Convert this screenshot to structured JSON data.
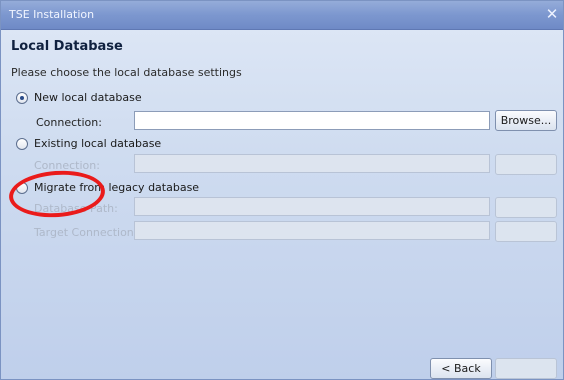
{
  "window": {
    "title": "TSE Installation",
    "close_icon": "close-icon"
  },
  "page": {
    "heading": "Local Database",
    "subheading": "Please choose the local database settings"
  },
  "options": {
    "new_db": {
      "label": "New local database",
      "selected": true
    },
    "existing_db": {
      "label": "Existing local database",
      "selected": false
    },
    "migrate_db": {
      "label": "Migrate from legacy database",
      "selected": false
    }
  },
  "fields": {
    "new_connection_label": "Connection:",
    "new_connection_value": "",
    "existing_connection_label": "Connection:",
    "existing_connection_value": "",
    "database_path_label": "Database Path:",
    "database_path_value": "",
    "target_connection_label": "Target Connection:",
    "target_connection_value": ""
  },
  "buttons": {
    "browse_label": "Browse...",
    "back_label": "< Back"
  },
  "colors": {
    "annotation": "#ea1b1b",
    "title_bar": "#7c97cf"
  }
}
